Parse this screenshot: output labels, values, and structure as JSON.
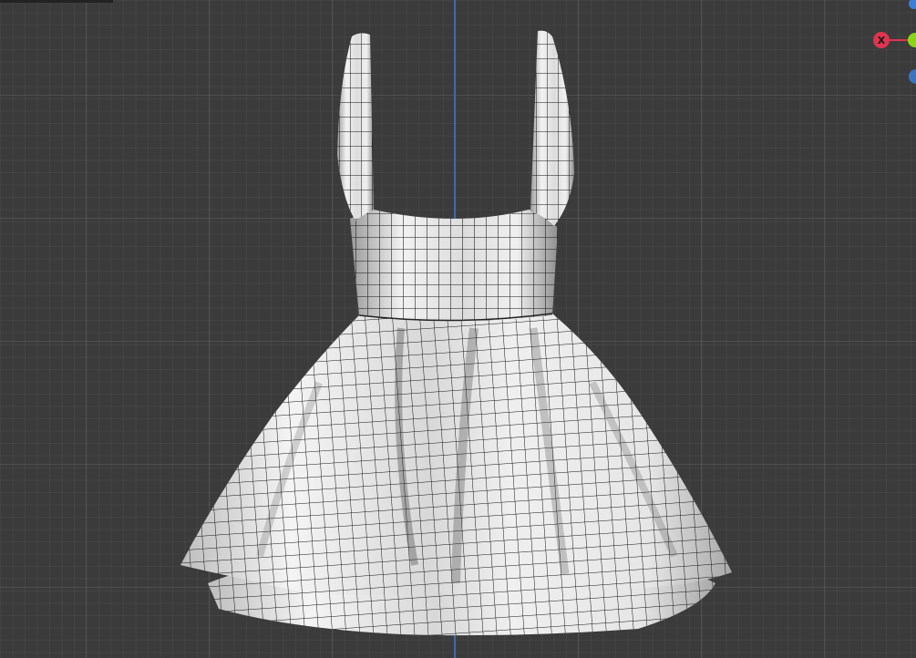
{
  "viewport": {
    "background_color": "#3b3b3b",
    "axis_color": "#3f6fb0",
    "mesh_color": "#e8e8e8",
    "wire_color": "#111111"
  },
  "gizmo": {
    "x_label": "X",
    "x_color": "#e0344f",
    "y_color": "#8bd41a",
    "z_color": "#3c7ed8"
  }
}
